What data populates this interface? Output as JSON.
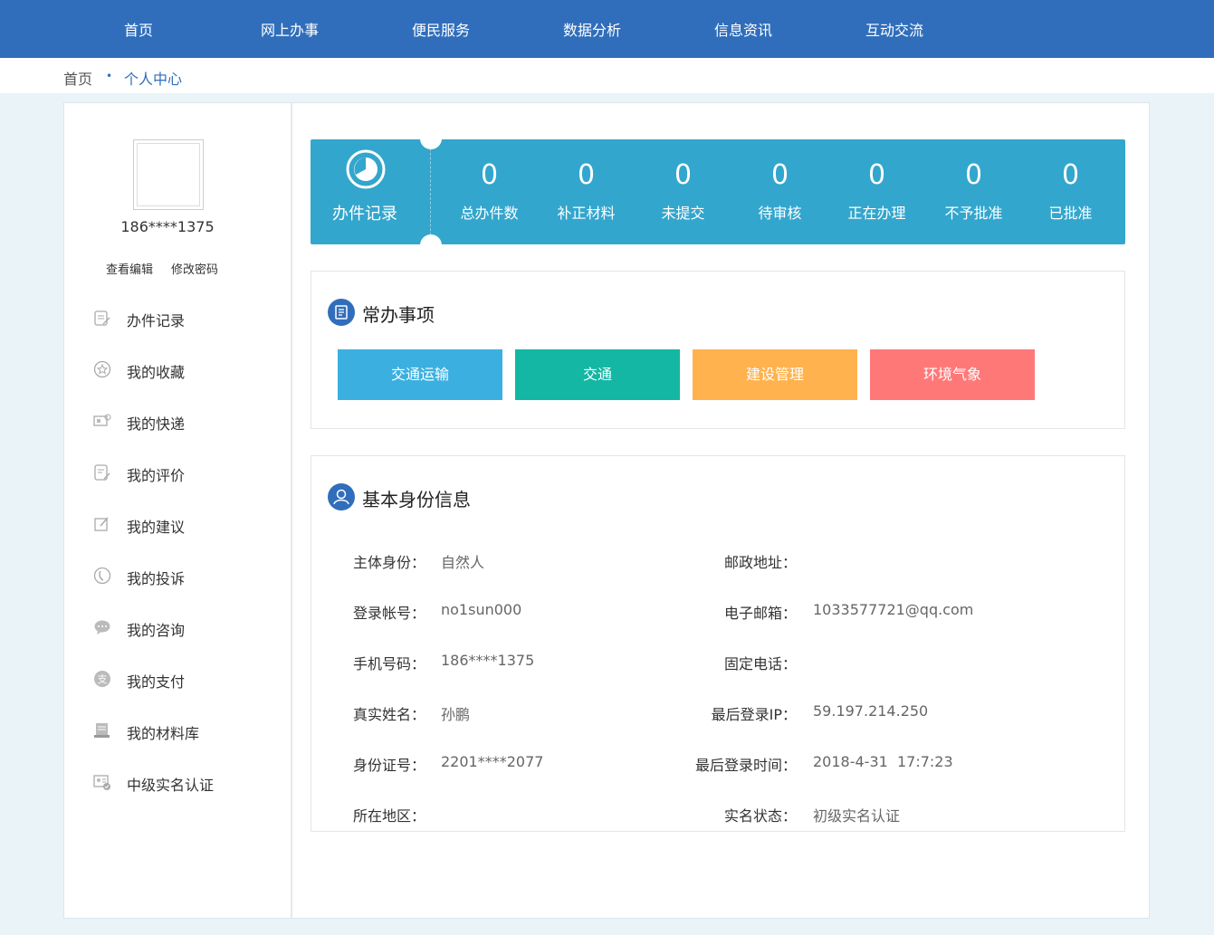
{
  "nav": {
    "items": [
      "首页",
      "网上办事",
      "便民服务",
      "数据分析",
      "信息资讯",
      "互动交流"
    ]
  },
  "breadcrumb": {
    "home": "首页",
    "separator": "•",
    "current": "个人中心"
  },
  "user": {
    "phone": "186****1375",
    "view_edit": "查看编辑",
    "change_password": "修改密码"
  },
  "sidebar": {
    "items": [
      {
        "label": "办件记录",
        "icon": "records-icon"
      },
      {
        "label": "我的收藏",
        "icon": "star-icon"
      },
      {
        "label": "我的快递",
        "icon": "express-icon"
      },
      {
        "label": "我的评价",
        "icon": "review-icon"
      },
      {
        "label": "我的建议",
        "icon": "edit-icon"
      },
      {
        "label": "我的投诉",
        "icon": "phone-icon"
      },
      {
        "label": "我的咨询",
        "icon": "chat-icon"
      },
      {
        "label": "我的支付",
        "icon": "payment-icon"
      },
      {
        "label": "我的材料库",
        "icon": "library-icon"
      },
      {
        "label": "中级实名认证",
        "icon": "id-verify-icon"
      }
    ]
  },
  "stats": {
    "record_label": "办件记录",
    "items": [
      {
        "value": "0",
        "label": "总办件数"
      },
      {
        "value": "0",
        "label": "补正材料"
      },
      {
        "value": "0",
        "label": "未提交"
      },
      {
        "value": "0",
        "label": "待审核"
      },
      {
        "value": "0",
        "label": "正在办理"
      },
      {
        "value": "0",
        "label": "不予批准"
      },
      {
        "value": "0",
        "label": "已批准"
      }
    ]
  },
  "common": {
    "title": "常办事项",
    "buttons": [
      {
        "label": "交通运输",
        "color": "#3bb0e0"
      },
      {
        "label": "交通",
        "color": "#13b7a4"
      },
      {
        "label": "建设管理",
        "color": "#ffb24d"
      },
      {
        "label": "环境气象",
        "color": "#ff7878"
      }
    ]
  },
  "identity": {
    "title": "基本身份信息",
    "left": [
      {
        "key": "主体身份：",
        "value": "自然人"
      },
      {
        "key": "登录帐号：",
        "value": "no1sun000"
      },
      {
        "key": "手机号码：",
        "value": "186****1375"
      },
      {
        "key": "真实姓名：",
        "value": "孙鹏"
      },
      {
        "key": "身份证号：",
        "value": "2201****2077"
      },
      {
        "key": "所在地区：",
        "value": ""
      }
    ],
    "right": [
      {
        "key": "邮政地址：",
        "value": ""
      },
      {
        "key": "电子邮箱：",
        "value": "1033577721@qq.com"
      },
      {
        "key": "固定电话：",
        "value": ""
      },
      {
        "key": "最后登录IP：",
        "value": "59.197.214.250"
      },
      {
        "key": "最后登录时间：",
        "value": "2018-4-31  17:7:23"
      },
      {
        "key": "实名状态：",
        "value": "初级实名认证"
      }
    ]
  },
  "colors": {
    "nav": "#306ebb",
    "stats": "#33a6cd",
    "accent": "#306ebb"
  }
}
